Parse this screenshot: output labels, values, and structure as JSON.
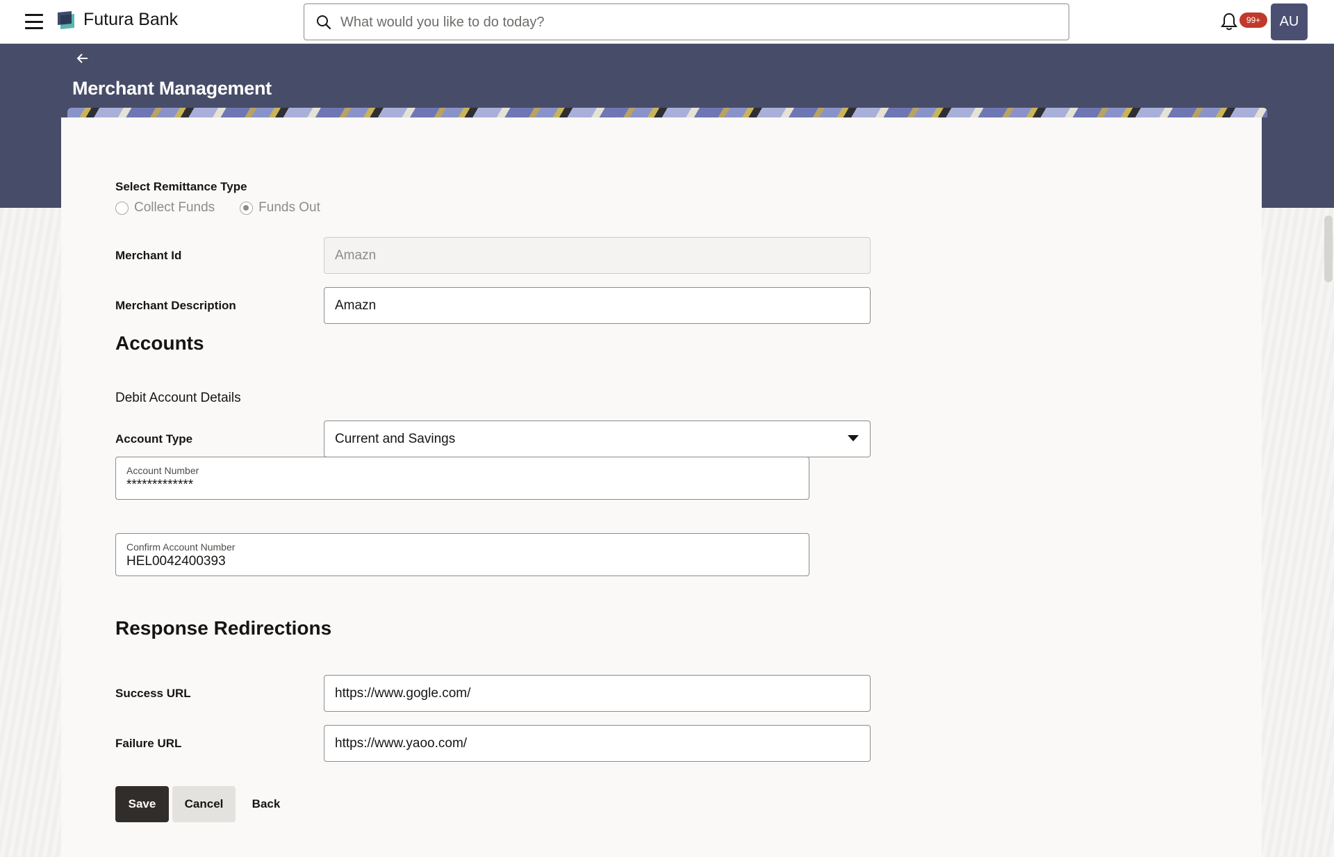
{
  "header": {
    "brand": "Futura Bank",
    "search_placeholder": "What would you like to do today?",
    "notification_count": "99+",
    "user_initials": "AU"
  },
  "page": {
    "title": "Merchant Management"
  },
  "form": {
    "remittance": {
      "label": "Select Remittance Type",
      "options": [
        "Collect Funds",
        "Funds Out"
      ],
      "selected": "Funds Out"
    },
    "merchant_id": {
      "label": "Merchant Id",
      "value": "Amazn"
    },
    "merchant_description": {
      "label": "Merchant Description",
      "value": "Amazn"
    },
    "accounts": {
      "heading": "Accounts",
      "subheading": "Debit Account Details",
      "account_type": {
        "label": "Account Type",
        "value": "Current and Savings"
      },
      "account_number": {
        "label": "Account Number",
        "value": "*************"
      },
      "confirm_account_number": {
        "label": "Confirm Account Number",
        "value": "HEL0042400393"
      }
    },
    "redirections": {
      "heading": "Response Redirections",
      "success_url": {
        "label": "Success URL",
        "value": "https://www.gogle.com/"
      },
      "failure_url": {
        "label": "Failure URL",
        "value": "https://www.yaoo.com/"
      }
    }
  },
  "actions": {
    "save": "Save",
    "cancel": "Cancel",
    "back": "Back"
  },
  "colors": {
    "hero_bg": "#474c68",
    "primary_button": "#312d2a",
    "avatar_bg": "#4b5072",
    "badge": "#c0392b"
  }
}
